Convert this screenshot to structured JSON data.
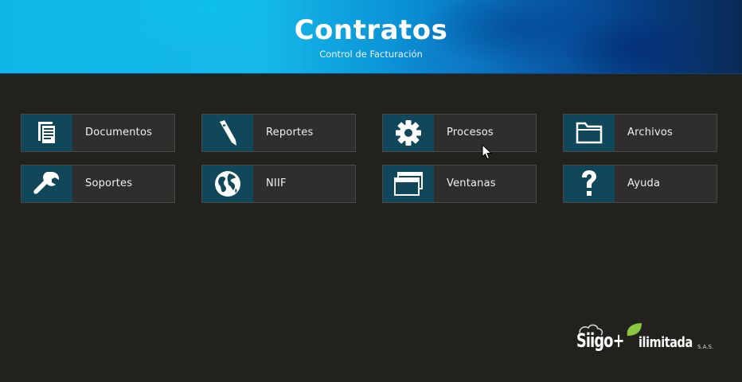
{
  "header": {
    "title": "Contratos",
    "subtitle": "Control de Facturación"
  },
  "menu": [
    {
      "label": "Documentos",
      "icon": "document-icon"
    },
    {
      "label": "Reportes",
      "icon": "pen-icon"
    },
    {
      "label": "Procesos",
      "icon": "gear-icon"
    },
    {
      "label": "Archivos",
      "icon": "folder-icon"
    },
    {
      "label": "Soportes",
      "icon": "wrench-icon"
    },
    {
      "label": "NIIF",
      "icon": "globe-icon"
    },
    {
      "label": "Ventanas",
      "icon": "windows-icon"
    },
    {
      "label": "Ayuda",
      "icon": "question-icon"
    }
  ],
  "logo": {
    "brand": "Siigo+",
    "company": "ilimitada",
    "suffix": "S.A.S."
  },
  "colors": {
    "background": "#22211d",
    "tile": "#2f2e2c",
    "icon_panel": "#10475a",
    "header_light": "#0fb7e8",
    "header_dark": "#063e85",
    "accent_green": "#8cc63f"
  }
}
